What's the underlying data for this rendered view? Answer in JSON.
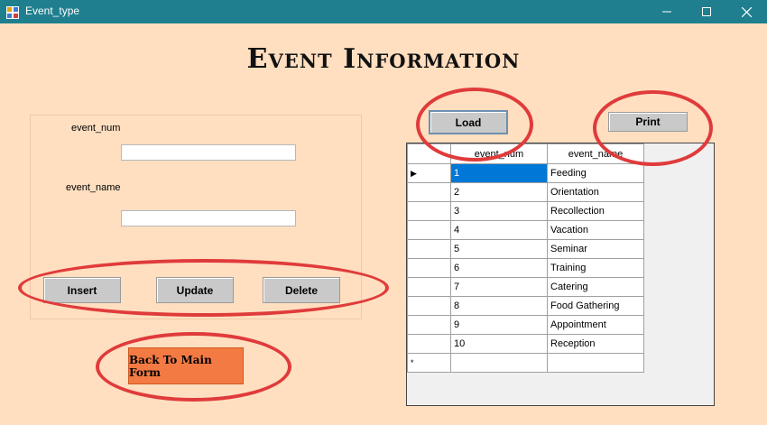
{
  "window": {
    "title": "Event_type"
  },
  "heading": "Event Information",
  "form": {
    "event_num_label": "event_num",
    "event_num_value": "",
    "event_name_label": "event_name",
    "event_name_value": ""
  },
  "buttons": {
    "insert": "Insert",
    "update": "Update",
    "delete": "Delete",
    "load": "Load",
    "print": "Print",
    "back": "Back To Main Form"
  },
  "grid": {
    "columns": [
      "event_num",
      "event_name"
    ],
    "rows": [
      {
        "num": "1",
        "name": "Feeding"
      },
      {
        "num": "2",
        "name": "Orientation"
      },
      {
        "num": "3",
        "name": "Recollection"
      },
      {
        "num": "4",
        "name": "Vacation"
      },
      {
        "num": "5",
        "name": "Seminar"
      },
      {
        "num": "6",
        "name": "Training"
      },
      {
        "num": "7",
        "name": "Catering"
      },
      {
        "num": "8",
        "name": "Food Gathering"
      },
      {
        "num": "9",
        "name": "Appointment"
      },
      {
        "num": "10",
        "name": "Reception"
      }
    ],
    "current_row_marker": "▶",
    "new_row_marker": "*"
  },
  "colors": {
    "titlebar": "#1f7f8f",
    "background": "#ffdfc0",
    "annotation": "#e03b3b",
    "back_button": "#f47a43",
    "selection": "#0078d7"
  },
  "icons": [
    "app-icon",
    "minimize-icon",
    "maximize-icon",
    "close-icon"
  ]
}
